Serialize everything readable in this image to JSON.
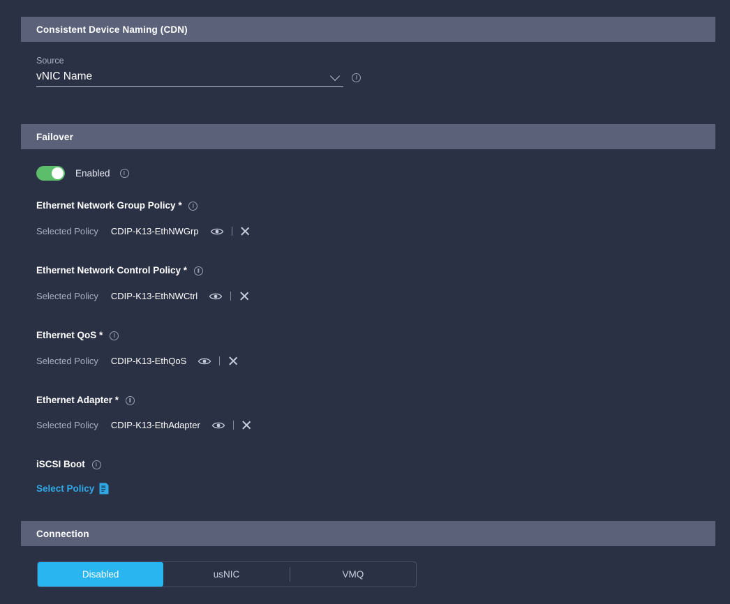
{
  "sections": {
    "cdn": {
      "header": "Consistent Device Naming (CDN)",
      "source_label": "Source",
      "source_value": "vNIC Name"
    },
    "failover": {
      "header": "Failover",
      "toggle_label": "Enabled",
      "toggle_state": "on",
      "policies": [
        {
          "title": "Ethernet Network Group Policy",
          "required": "*",
          "selected_label": "Selected Policy",
          "selected_value": "CDIP-K13-EthNWGrp"
        },
        {
          "title": "Ethernet Network Control Policy",
          "required": "*",
          "selected_label": "Selected Policy",
          "selected_value": "CDIP-K13-EthNWCtrl"
        },
        {
          "title": "Ethernet QoS",
          "required": "*",
          "selected_label": "Selected Policy",
          "selected_value": "CDIP-K13-EthQoS"
        },
        {
          "title": "Ethernet Adapter",
          "required": "*",
          "selected_label": "Selected Policy",
          "selected_value": "CDIP-K13-EthAdapter"
        }
      ],
      "iscsi": {
        "title": "iSCSI Boot",
        "select_policy_label": "Select Policy"
      }
    },
    "connection": {
      "header": "Connection",
      "options": [
        {
          "label": "Disabled",
          "active": true
        },
        {
          "label": "usNIC",
          "active": false
        },
        {
          "label": "VMQ",
          "active": false
        }
      ]
    }
  },
  "colors": {
    "page_bg": "#2b3145",
    "section_header_bg": "#5b6179",
    "accent_blue": "#29b5f0",
    "toggle_green": "#5cbd6b",
    "link_blue": "#2fa8e8"
  },
  "icons": {
    "info": "info-icon",
    "chevron_down": "chevron-down-icon",
    "eye": "eye-icon",
    "close": "close-icon",
    "document": "document-icon"
  }
}
